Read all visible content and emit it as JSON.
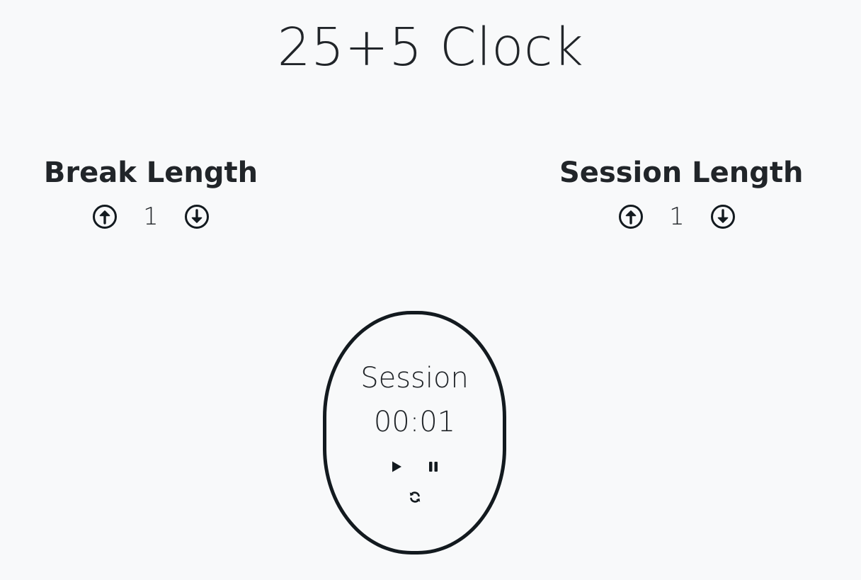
{
  "app": {
    "title": "25+5 Clock"
  },
  "break_control": {
    "label": "Break Length",
    "value": "1",
    "increment_icon": "arrow-circle-up-icon",
    "decrement_icon": "arrow-circle-down-icon"
  },
  "session_control": {
    "label": "Session Length",
    "value": "1",
    "increment_icon": "arrow-circle-up-icon",
    "decrement_icon": "arrow-circle-down-icon"
  },
  "timer": {
    "label": "Session",
    "time_left": "00:01",
    "play_icon": "play-icon",
    "pause_icon": "pause-icon",
    "reset_icon": "refresh-icon"
  },
  "colors": {
    "background": "#f8f9fa",
    "text": "#212529",
    "timer_border": "#131a1f"
  }
}
